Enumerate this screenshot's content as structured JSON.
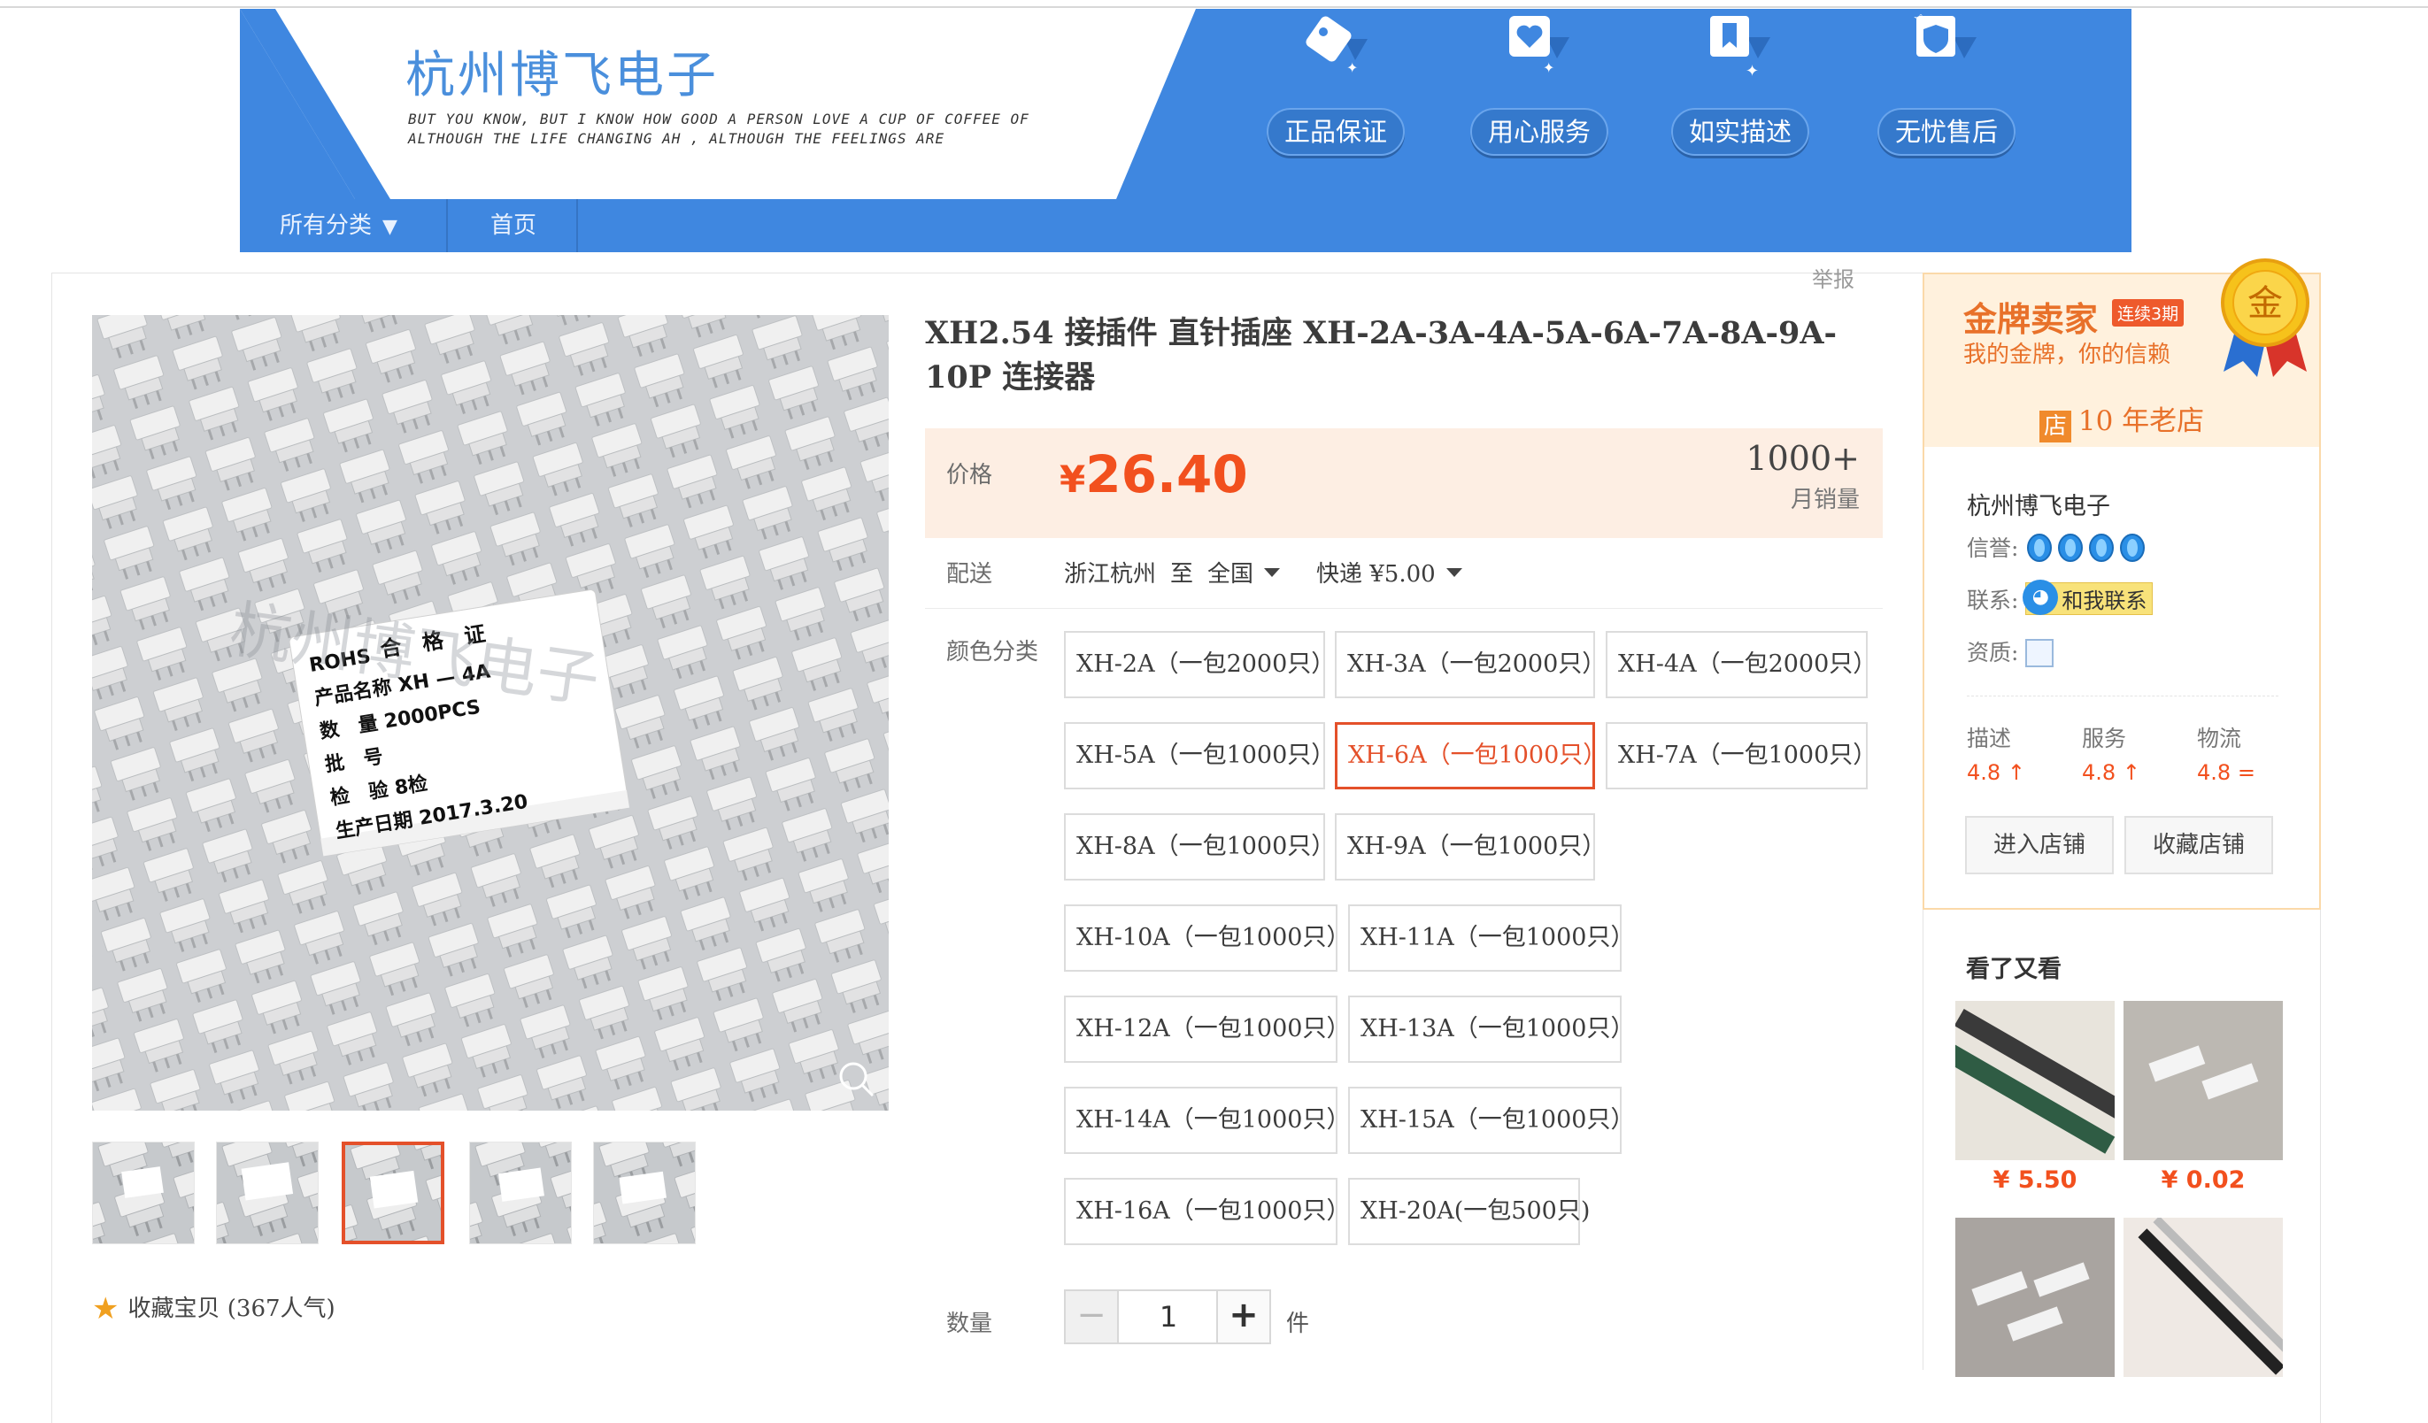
{
  "shop": {
    "name": "杭州博飞电子",
    "slogan_line1": "BUT YOU KNOW, BUT I KNOW HOW GOOD A PERSON LOVE A CUP OF COFFEE OF",
    "slogan_line2": "ALTHOUGH THE LIFE CHANGING AH , ALTHOUGH THE FEELINGS ARE",
    "badges": [
      "正品保证",
      "用心服务",
      "如实描述",
      "无忧售后"
    ],
    "nav": {
      "all_categories": "所有分类",
      "home": "首页"
    }
  },
  "report": "举报",
  "gallery": {
    "watermark": "杭州博飞电子",
    "label_lines": [
      "ROHS",
      "合　格　证",
      "产品名称 XH — 4A",
      "数　量 2000PCS",
      "批　号",
      "检　验 8检",
      "生产日期 2017.3.20"
    ],
    "favorite": "收藏宝贝",
    "popularity": "(367人气)",
    "thumb_count": 5,
    "selected_thumb": 3
  },
  "product": {
    "title": "XH2.54 接插件 直针插座 XH-2A-3A-4A-5A-6A-7A-8A-9A-10P 连接器",
    "price_label": "价格",
    "currency": "¥",
    "price": "26.40",
    "sales": "1000+",
    "sales_label": "月销量",
    "shipping_label": "配送",
    "ship_from": "浙江杭州",
    "ship_to_word": "至",
    "ship_to": "全国",
    "express": "快递 ¥5.00",
    "color_label": "颜色分类",
    "skus": [
      "XH-2A（一包2000只）",
      "XH-3A（一包2000只）",
      "XH-4A（一包2000只）",
      "XH-5A（一包1000只）",
      "XH-6A（一包1000只）",
      "XH-7A（一包1000只）",
      "XH-8A（一包1000只）",
      "XH-9A（一包1000只）",
      "XH-10A（一包1000只）",
      "XH-11A（一包1000只）",
      "XH-12A（一包1000只）",
      "XH-13A（一包1000只）",
      "XH-14A（一包1000只）",
      "XH-15A（一包1000只）",
      "XH-16A（一包1000只）",
      "XH-20A(一包500只)"
    ],
    "selected_sku": "XH-6A（一包1000只）",
    "quantity_label": "数量",
    "quantity": "1",
    "minus": "−",
    "plus": "+",
    "unit": "件"
  },
  "seller": {
    "gold_title": "金牌卖家",
    "gold_tag": "连续3期",
    "gold_sub": "我的金牌，你的信赖",
    "medal_char": "金",
    "old_shop_icon": "店",
    "old_shop": "10 年老店",
    "shop_name": "杭州博飞电子",
    "credit_label": "信誉:",
    "credit_crowns": 4,
    "contact_label": "联系:",
    "contact_button": "和我联系",
    "license_label": "资质:",
    "scores": [
      {
        "label": "描述",
        "value": "4.8",
        "trend": "↑"
      },
      {
        "label": "服务",
        "value": "4.8",
        "trend": "↑"
      },
      {
        "label": "物流",
        "value": "4.8",
        "trend": "="
      }
    ],
    "enter_shop": "进入店铺",
    "favorite_shop": "收藏店铺"
  },
  "also_viewed": {
    "title": "看了又看",
    "items": [
      {
        "price": "¥ 5.50"
      },
      {
        "price": "¥ 0.02"
      },
      {
        "price": ""
      },
      {
        "price": ""
      }
    ]
  },
  "colors": {
    "accent": "#f2501e",
    "selected_border": "#e4502a",
    "banner_blue": "#3f87e0",
    "gold": "#e8712a"
  }
}
